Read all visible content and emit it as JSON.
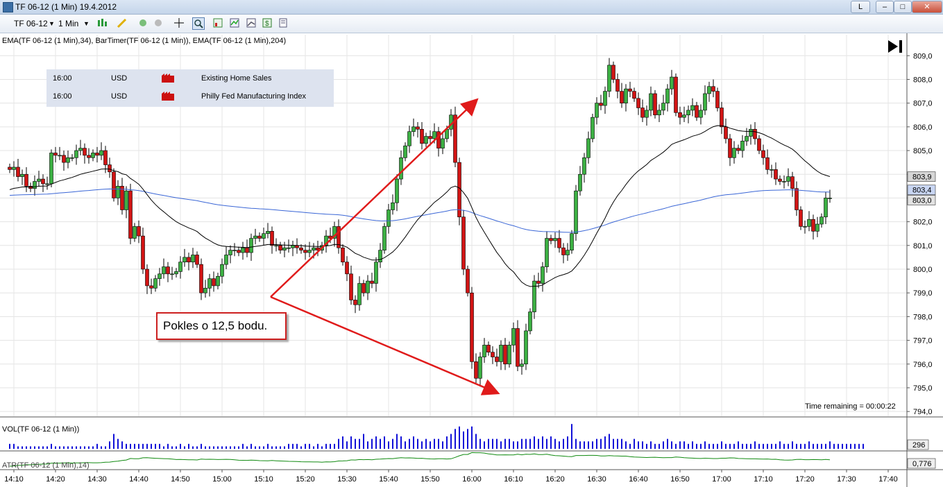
{
  "window": {
    "title": "TF 06-12 (1 Min)  19.4.2012",
    "buttons": {
      "link": "L",
      "minimize": "–",
      "maximize": "□",
      "close": "✕"
    }
  },
  "toolbar": {
    "instrument": "TF 06-12",
    "interval": "1 Min",
    "icons": [
      "bar-type-icon",
      "draw-pencil-icon",
      "crosshair-icon",
      "zoom-icon",
      "strategy-icon",
      "indicator-icon",
      "data-box-icon",
      "dollar-icon",
      "properties-icon"
    ]
  },
  "indicators_label": "EMA(TF 06-12 (1 Min),34), BarTimer(TF 06-12 (1 Min)), EMA(TF 06-12 (1 Min),204)",
  "events": [
    {
      "time": "16:00",
      "currency": "USD",
      "name": "Existing Home Sales"
    },
    {
      "time": "16:00",
      "currency": "USD",
      "name": "Philly Fed Manufacturing Index"
    }
  ],
  "annotation": "Pokles o 12,5 bodu.",
  "time_remaining": "Time remaining = 00:00:22",
  "volume_label": "VOL(TF 06-12 (1 Min))",
  "atr_label": "ATR(TF 06-12 (1 Min),14)",
  "price_tags": {
    "ema34": "803,9",
    "ema204": "803,4",
    "last": "803,0",
    "volume": "296",
    "atr": "0,776"
  },
  "colors": {
    "up": "#3cb043",
    "down": "#d11414",
    "ema34": "#000000",
    "ema204": "#3a66d6",
    "volume": "#1010d8",
    "atr": "#118a11",
    "arrow": "#e01b1b"
  },
  "chart_data": {
    "type": "candlestick",
    "ylim": [
      793.8,
      809.3
    ],
    "yticks": [
      "809,0",
      "808,0",
      "807,0",
      "806,0",
      "805,0",
      "804,0",
      "803,0",
      "802,0",
      "801,0",
      "800,0",
      "799,0",
      "798,0",
      "797,0",
      "796,0",
      "795,0",
      "794,0"
    ],
    "xticks": [
      "14:10",
      "14:20",
      "14:30",
      "14:40",
      "14:50",
      "15:00",
      "15:10",
      "15:20",
      "15:30",
      "15:40",
      "15:50",
      "16:00",
      "16:10",
      "16:20",
      "16:30",
      "16:40",
      "16:50",
      "17:00",
      "17:10",
      "17:20",
      "17:30",
      "17:40"
    ],
    "start_time": "14:09",
    "bar_minutes": 1,
    "closes": [
      804.2,
      804.3,
      803.9,
      804.0,
      803.5,
      803.4,
      803.7,
      803.8,
      803.6,
      803.6,
      804.9,
      804.8,
      804.8,
      804.5,
      804.7,
      804.7,
      805.0,
      805.1,
      804.8,
      804.7,
      804.9,
      804.8,
      805.0,
      804.4,
      804.1,
      803.0,
      803.5,
      802.5,
      803.3,
      801.3,
      801.8,
      801.4,
      800.0,
      799.3,
      799.2,
      799.6,
      799.8,
      800.1,
      799.8,
      799.8,
      799.9,
      800.3,
      800.5,
      800.3,
      800.6,
      800.2,
      799.0,
      799.2,
      799.6,
      799.3,
      799.7,
      800.2,
      800.6,
      800.8,
      800.8,
      800.7,
      800.9,
      800.7,
      801.3,
      801.4,
      801.3,
      801.5,
      801.6,
      801.0,
      801.0,
      800.8,
      800.9,
      800.9,
      801.0,
      800.9,
      800.8,
      800.7,
      800.8,
      800.9,
      800.8,
      801.0,
      801.4,
      801.3,
      801.8,
      800.9,
      800.3,
      799.8,
      798.7,
      798.5,
      799.4,
      799.0,
      799.5,
      799.4,
      800.3,
      800.8,
      801.8,
      802.5,
      802.8,
      803.8,
      804.7,
      805.2,
      805.8,
      806.0,
      805.9,
      805.3,
      805.6,
      805.5,
      805.8,
      805.1,
      805.5,
      805.9,
      806.5,
      804.5,
      802.2,
      800.0,
      799.0,
      796.1,
      795.4,
      796.3,
      796.8,
      796.5,
      796.3,
      796.1,
      796.8,
      796.0,
      796.8,
      797.5,
      795.9,
      796.0,
      797.4,
      798.2,
      799.5,
      799.4,
      800.1,
      801.3,
      801.2,
      801.3,
      800.9,
      800.6,
      800.8,
      801.5,
      803.3,
      804.0,
      804.7,
      805.5,
      806.4,
      807.0,
      806.9,
      807.5,
      808.6,
      808.0,
      807.5,
      807.0,
      807.6,
      807.5,
      807.2,
      806.8,
      806.4,
      806.7,
      807.4,
      806.5,
      806.7,
      807.0,
      807.6,
      808.1,
      806.6,
      806.4,
      806.5,
      806.7,
      806.9,
      806.4,
      806.7,
      807.4,
      807.7,
      807.5,
      806.8,
      806.0,
      805.5,
      804.7,
      805.1,
      805.0,
      805.4,
      805.6,
      805.9,
      805.5,
      805.0,
      804.7,
      804.2,
      804.2,
      803.8,
      803.7,
      803.7,
      803.9,
      803.4,
      802.5,
      801.8,
      801.8,
      802.1,
      801.6,
      801.9,
      802.2,
      803.0,
      803.0
    ]
  },
  "volume_data": [
    2,
    2,
    1,
    1,
    1,
    1,
    1,
    1,
    1,
    1,
    2,
    1,
    1,
    1,
    1,
    1,
    1,
    1,
    1,
    1,
    1,
    2,
    1,
    1,
    3,
    6,
    4,
    3,
    2,
    2,
    2,
    2,
    2,
    2,
    2,
    2,
    2,
    1,
    2,
    1,
    1,
    2,
    1,
    2,
    1,
    1,
    2,
    1,
    1,
    1,
    1,
    1,
    1,
    1,
    1,
    1,
    2,
    1,
    2,
    1,
    1,
    1,
    2,
    1,
    1,
    1,
    1,
    2,
    2,
    2,
    1,
    2,
    2,
    1,
    2,
    1,
    2,
    2,
    2,
    4,
    5,
    3,
    5,
    4,
    4,
    6,
    3,
    4,
    5,
    4,
    5,
    3,
    4,
    6,
    5,
    3,
    4,
    5,
    4,
    3,
    4,
    3,
    4,
    4,
    3,
    5,
    6,
    8,
    9,
    7,
    8,
    9,
    6,
    4,
    3,
    4,
    4,
    4,
    3,
    4,
    4,
    3,
    3,
    4,
    4,
    4,
    5,
    4,
    5,
    4,
    5,
    4,
    3,
    4,
    5,
    10,
    4,
    3,
    3,
    3,
    3,
    4,
    4,
    5,
    6,
    4,
    4,
    4,
    3,
    2,
    4,
    3,
    3,
    2,
    3,
    2,
    2,
    3,
    4,
    3,
    2,
    3,
    3,
    2,
    3,
    2,
    2,
    3,
    2,
    2,
    2,
    3,
    2,
    2,
    2,
    3,
    2,
    2,
    2,
    3,
    2,
    2,
    2,
    2,
    2,
    3,
    2,
    2,
    3,
    2,
    2,
    2,
    3,
    2,
    2,
    2,
    2,
    3,
    2,
    2,
    2,
    2,
    2,
    2,
    2,
    2
  ]
}
